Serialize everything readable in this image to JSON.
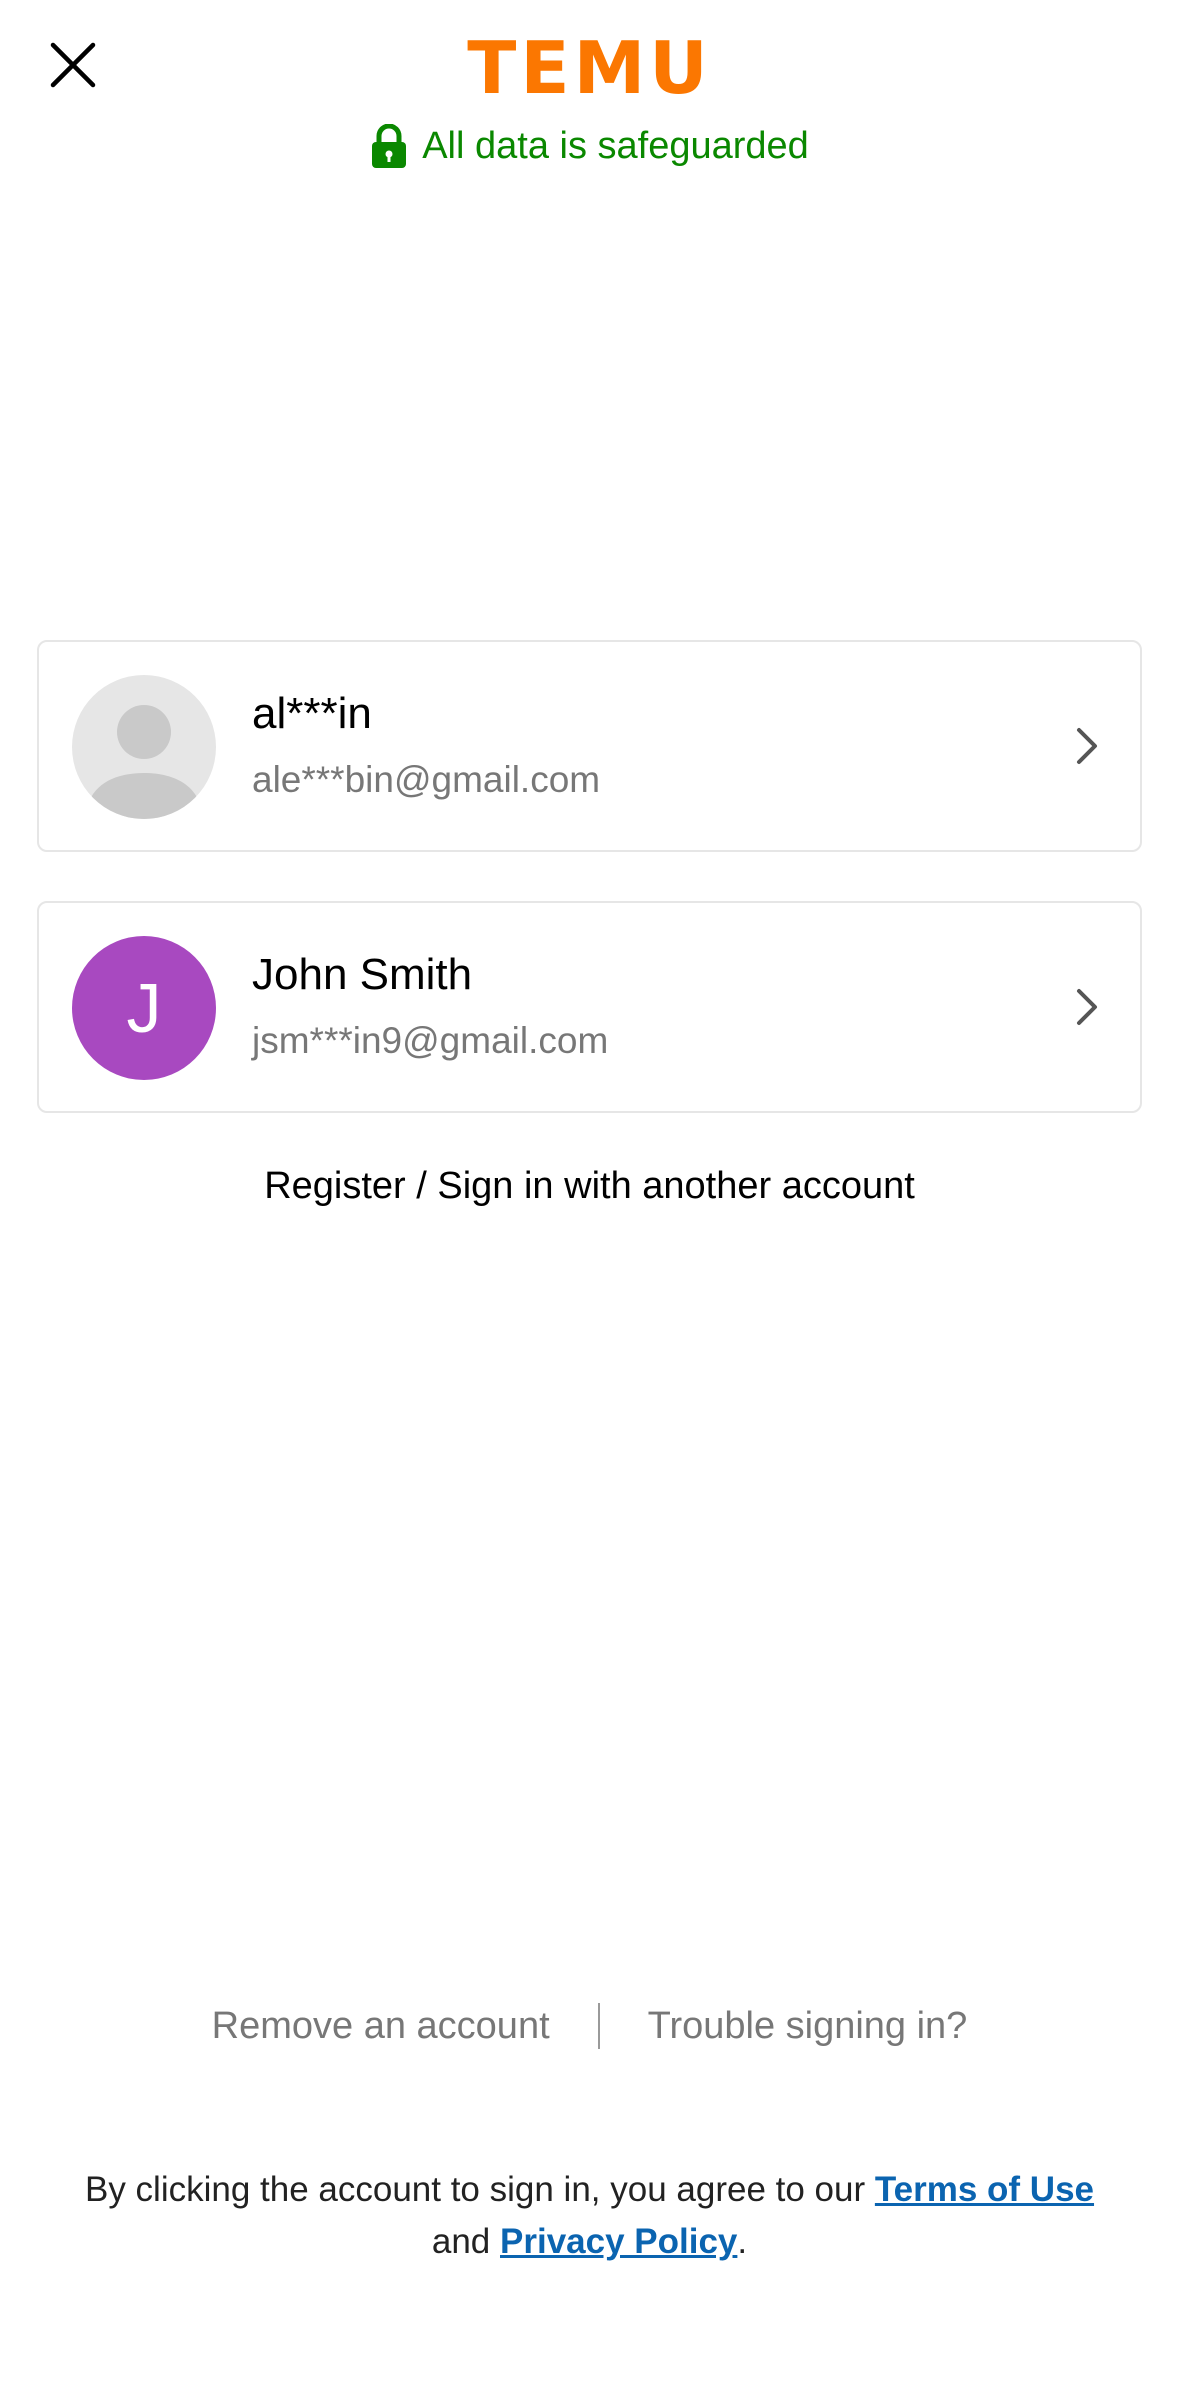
{
  "header": {
    "logo_text": "TEMU",
    "brand_color": "#fb7701",
    "safeguard_text": "All data is safeguarded",
    "safeguard_color": "#0a8800",
    "close_icon": "close-icon",
    "lock_icon": "lock-icon"
  },
  "accounts": [
    {
      "name": "al***in",
      "email": "ale***bin@gmail.com",
      "avatar_type": "default-person-icon"
    },
    {
      "name": "John Smith",
      "email": "jsm***in9@gmail.com",
      "avatar_letter": "J",
      "avatar_color": "#a849c0"
    }
  ],
  "another_account_label": "Register / Sign in with another account",
  "footer": {
    "remove_label": "Remove an account",
    "trouble_label": "Trouble signing in?",
    "legal_prefix": "By clicking the account to sign in, you agree to our ",
    "terms_label": "Terms of Use",
    "legal_and": " and ",
    "privacy_label": "Privacy Policy",
    "legal_suffix": "."
  }
}
